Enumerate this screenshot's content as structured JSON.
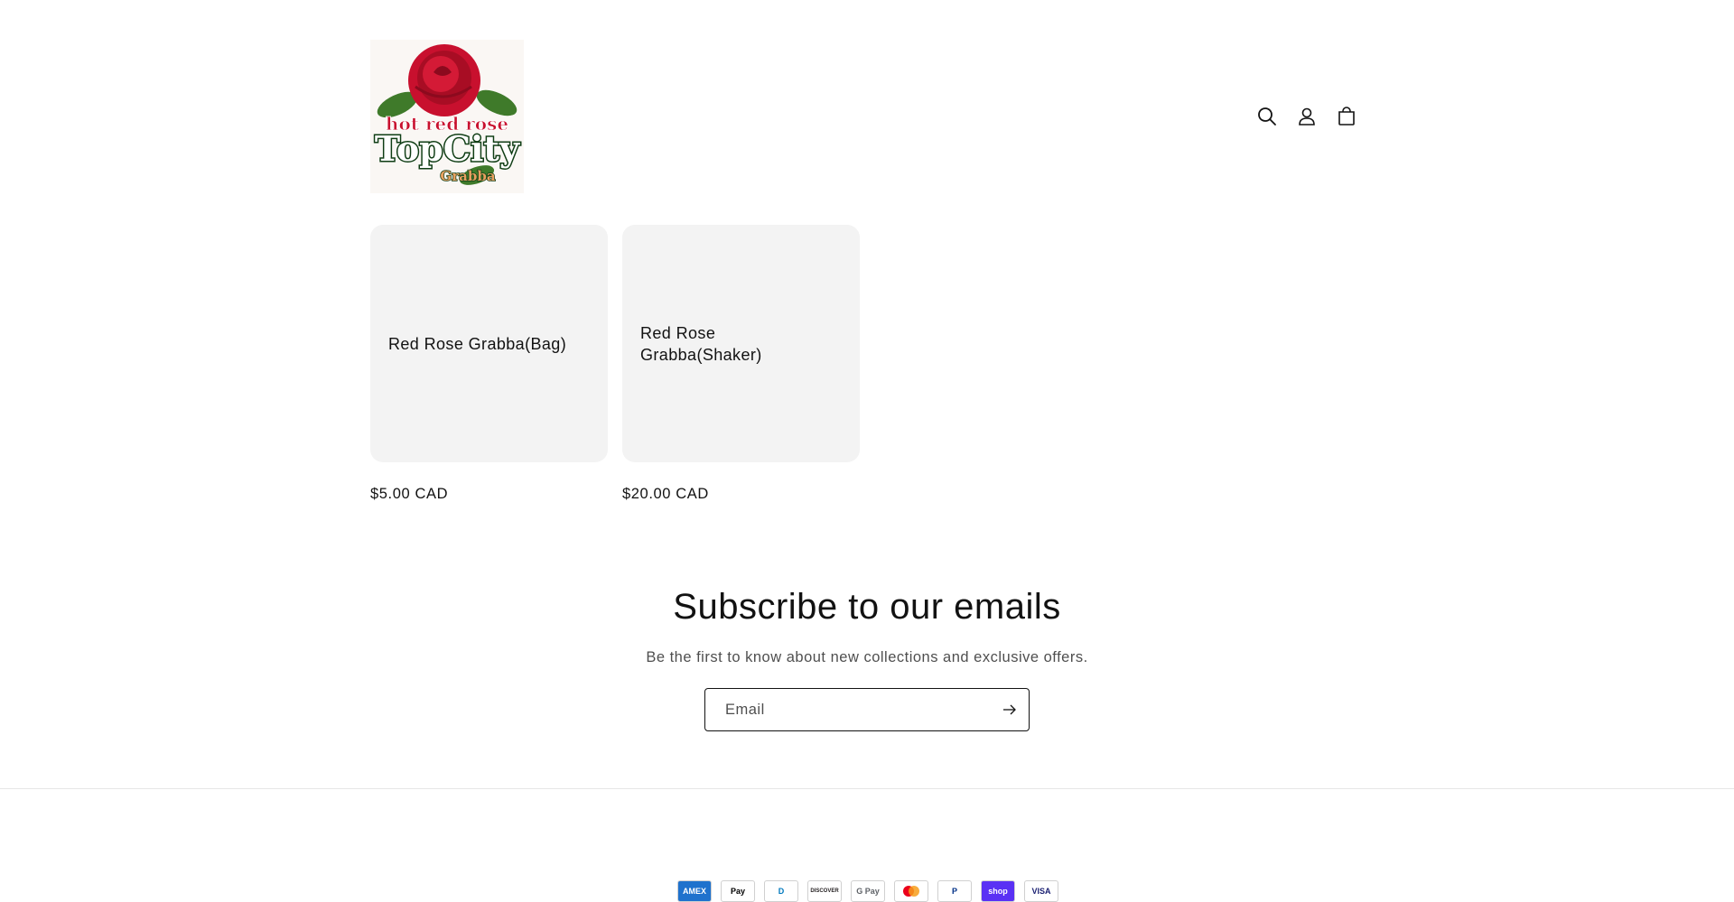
{
  "header": {
    "logo": {
      "line1": "hot red rose",
      "line2": "TopCity",
      "line3": "Grabba"
    },
    "icons": [
      "search-icon",
      "account-icon",
      "cart-icon"
    ]
  },
  "products": [
    {
      "title": "Red Rose Grabba(Bag)",
      "price": "$5.00 CAD"
    },
    {
      "title": "Red Rose Grabba(Shaker)",
      "price": "$20.00 CAD"
    }
  ],
  "newsletter": {
    "title": "Subscribe to our emails",
    "description": "Be the first to know about new collections and exclusive offers.",
    "email_placeholder": "Email",
    "email_value": ""
  },
  "payment_methods": [
    {
      "label": "AMEX",
      "bg": "#1f72cd",
      "fg": "#ffffff"
    },
    {
      "label": "Pay",
      "bg": "#ffffff",
      "fg": "#000000"
    },
    {
      "label": "D",
      "bg": "#ffffff",
      "fg": "#0079be"
    },
    {
      "label": "DISCOVER",
      "bg": "#ffffff",
      "fg": "#231f20"
    },
    {
      "label": "G Pay",
      "bg": "#ffffff",
      "fg": "#5f6368"
    },
    {
      "label": "",
      "bg": "#ffffff",
      "fg": "#eb001b"
    },
    {
      "label": "P",
      "bg": "#ffffff",
      "fg": "#003087"
    },
    {
      "label": "shop",
      "bg": "#5a31f4",
      "fg": "#ffffff"
    },
    {
      "label": "VISA",
      "bg": "#ffffff",
      "fg": "#1a1f71"
    }
  ],
  "colors": {
    "text": "#121212",
    "card_bg": "#f3f3f3",
    "logo_red": "#c8102e",
    "logo_green": "#1b5e20"
  }
}
